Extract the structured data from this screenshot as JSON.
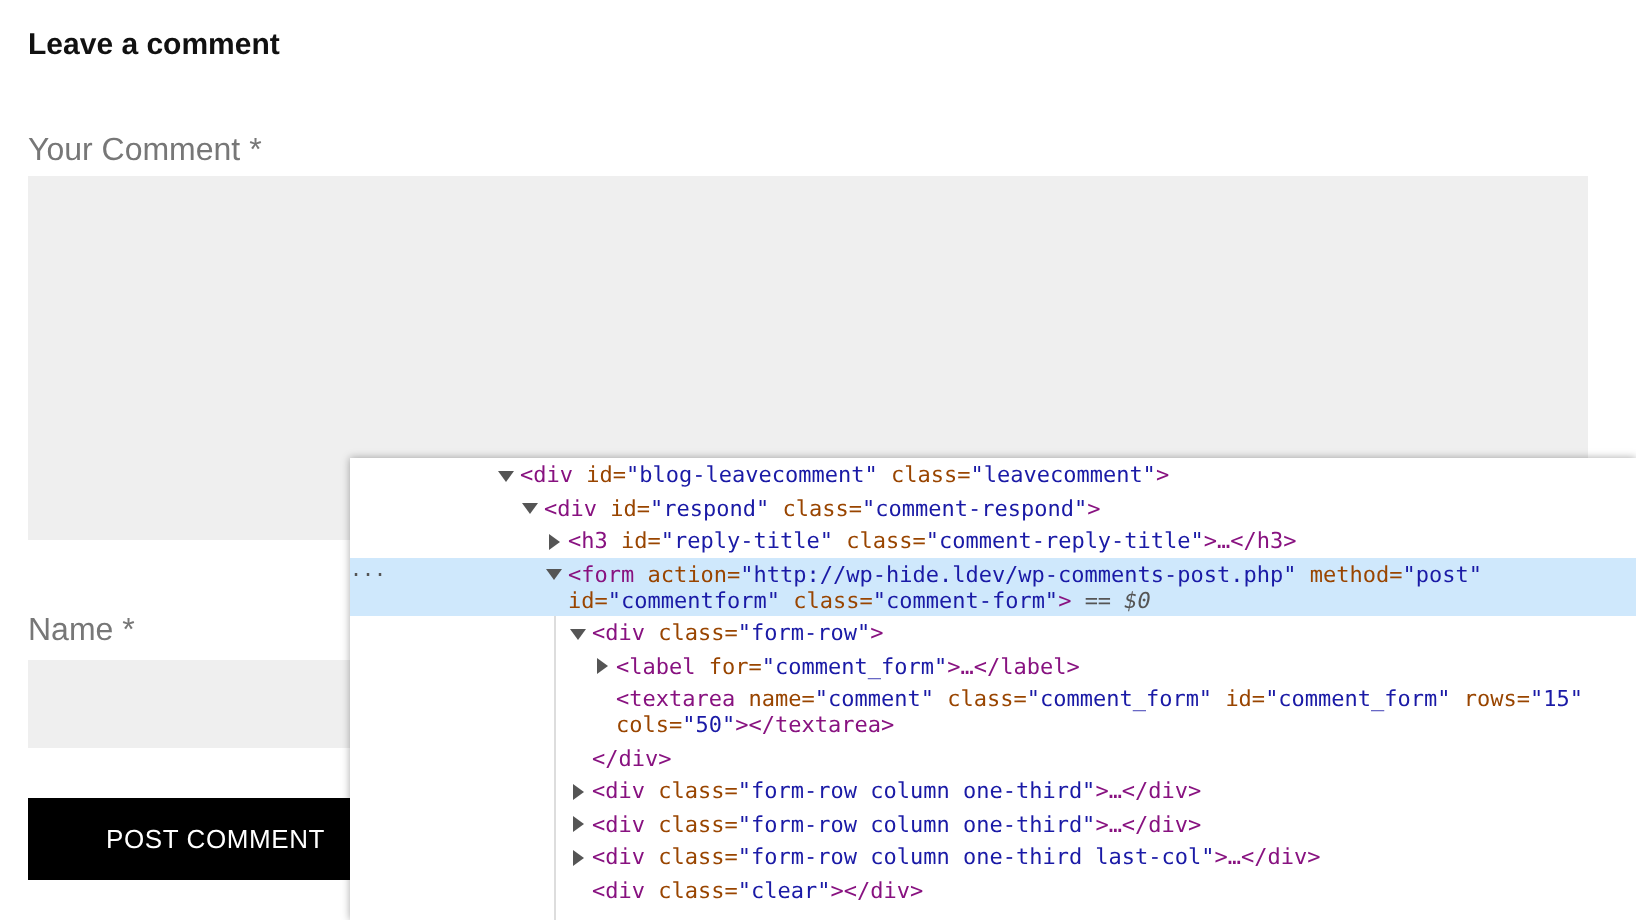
{
  "page": {
    "heading": "Leave a comment",
    "comment_label": "Your Comment *",
    "name_label": "Name *",
    "submit_button": "POST COMMENT"
  },
  "devtools": {
    "tree": [
      {
        "open": "<div",
        "attrs": [
          {
            "name": "id=",
            "value": "\"blog-leavecomment\""
          },
          {
            "name": "class=",
            "value": "\"leavecomment\""
          }
        ],
        "close": ">",
        "expanded": true,
        "selected": false,
        "children": [
          {
            "open": "<div",
            "attrs": [
              {
                "name": "id=",
                "value": "\"respond\""
              },
              {
                "name": "class=",
                "value": "\"comment-respond\""
              }
            ],
            "close": ">",
            "expanded": true,
            "selected": false,
            "children": [
              {
                "open": "<h3",
                "attrs": [
                  {
                    "name": "id=",
                    "value": "\"reply-title\""
                  },
                  {
                    "name": "class=",
                    "value": "\"comment-reply-title\""
                  }
                ],
                "close": ">",
                "tail": "…</h3>",
                "expanded": false,
                "selected": false
              },
              {
                "open": "<form",
                "attrs": [
                  {
                    "name": "action=",
                    "value": "\"http://wp-hide.ldev/wp-comments-post.php\""
                  },
                  {
                    "name": "method=",
                    "value": "\"post\""
                  },
                  {
                    "name": "id=",
                    "value": "\"commentform\""
                  },
                  {
                    "name": "class=",
                    "value": "\"comment-form\""
                  }
                ],
                "close": ">",
                "marker": "== $0",
                "gutter": "...",
                "expanded": true,
                "selected": true,
                "children": [
                  {
                    "open": "<div",
                    "attrs": [
                      {
                        "name": "class=",
                        "value": "\"form-row\""
                      }
                    ],
                    "close": ">",
                    "end": "</div>",
                    "expanded": true,
                    "selected": false,
                    "children": [
                      {
                        "open": "<label",
                        "attrs": [
                          {
                            "name": "for=",
                            "value": "\"comment_form\""
                          }
                        ],
                        "close": ">",
                        "tail": "…</label>",
                        "expanded": false,
                        "selected": false
                      },
                      {
                        "open": "<textarea",
                        "attrs": [
                          {
                            "name": "name=",
                            "value": "\"comment\""
                          },
                          {
                            "name": "class=",
                            "value": "\"comment_form\""
                          },
                          {
                            "name": "id=",
                            "value": "\"comment_form\""
                          },
                          {
                            "name": "rows=",
                            "value": "\"15\""
                          },
                          {
                            "name": "cols=",
                            "value": "\"50\""
                          }
                        ],
                        "close": ">",
                        "tail": "</textarea>",
                        "selected": false
                      }
                    ]
                  },
                  {
                    "open": "<div",
                    "attrs": [
                      {
                        "name": "class=",
                        "value": "\"form-row column one-third\""
                      }
                    ],
                    "close": ">",
                    "tail": "…</div>",
                    "expanded": false,
                    "selected": false
                  },
                  {
                    "open": "<div",
                    "attrs": [
                      {
                        "name": "class=",
                        "value": "\"form-row column one-third\""
                      }
                    ],
                    "close": ">",
                    "tail": "…</div>",
                    "expanded": false,
                    "selected": false
                  },
                  {
                    "open": "<div",
                    "attrs": [
                      {
                        "name": "class=",
                        "value": "\"form-row column one-third last-col\""
                      }
                    ],
                    "close": ">",
                    "tail": "…</div>",
                    "expanded": false,
                    "selected": false
                  },
                  {
                    "open": "<div",
                    "attrs": [
                      {
                        "name": "class=",
                        "value": "\"clear\""
                      }
                    ],
                    "close": ">",
                    "tail": "</div>",
                    "selected": false
                  }
                ]
              }
            ]
          }
        ]
      }
    ]
  }
}
